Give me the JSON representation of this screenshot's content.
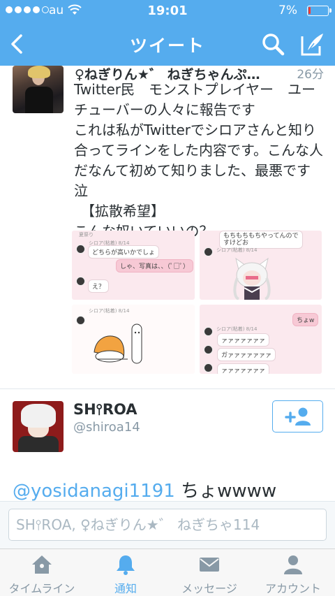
{
  "status_bar": {
    "carrier": "au",
    "time": "19:01",
    "battery": "7%"
  },
  "nav": {
    "title": "ツイート"
  },
  "tweet": {
    "author": "♀ねぎりん★゛ ねぎちゃんぷ…",
    "time": "26分",
    "text": "Twitter民　モンストプレイヤー　ユーチューバーの人々に報告です\nこれは私がTwitterでシロアさんと知り合ってラインをした内容です。こんな人だなんて初めて知りました、最悪です 泣\n　【拡散希望】\nこんな奴いていいの？",
    "images": {
      "img1": {
        "top_text": "夏祭り",
        "msg1": "どちらが高いかでしょ",
        "msg2": "しゃ、写真は、、（ﾟ□ﾟ）",
        "msg3": "え？",
        "name": "シロア(粘着) 8/14"
      },
      "img2": {
        "msg1": "もちもちもちやってんので\nすけどお",
        "name": "シロア(粘着) 8/14"
      },
      "img3": {
        "name": "シロア(粘着) 8/14"
      },
      "img4": {
        "msg1": "ちょw",
        "msg2": "ァァァァァァァ",
        "msg3": "ァァァァァァァ",
        "msg4": "ガァァァァァァァ",
        "name": "シロア(粘着) 8/14"
      }
    }
  },
  "user_card": {
    "name": "SH⫯ROA",
    "handle": "@shiroa14",
    "reply_mention": "@yosidanagi1191",
    "reply_text": " ちょwwww"
  },
  "composer": {
    "placeholder": "SH⫯ROA, ♀ねぎりん★゛ ねぎちゃ114"
  },
  "tabs": [
    {
      "label": "タイムライン",
      "icon": "home-icon"
    },
    {
      "label": "通知",
      "icon": "bell-icon"
    },
    {
      "label": "メッセージ",
      "icon": "envelope-icon"
    },
    {
      "label": "アカウント",
      "icon": "person-icon"
    }
  ],
  "colors": {
    "brand": "#55acee",
    "text": "#292f33",
    "muted": "#8899a6"
  }
}
